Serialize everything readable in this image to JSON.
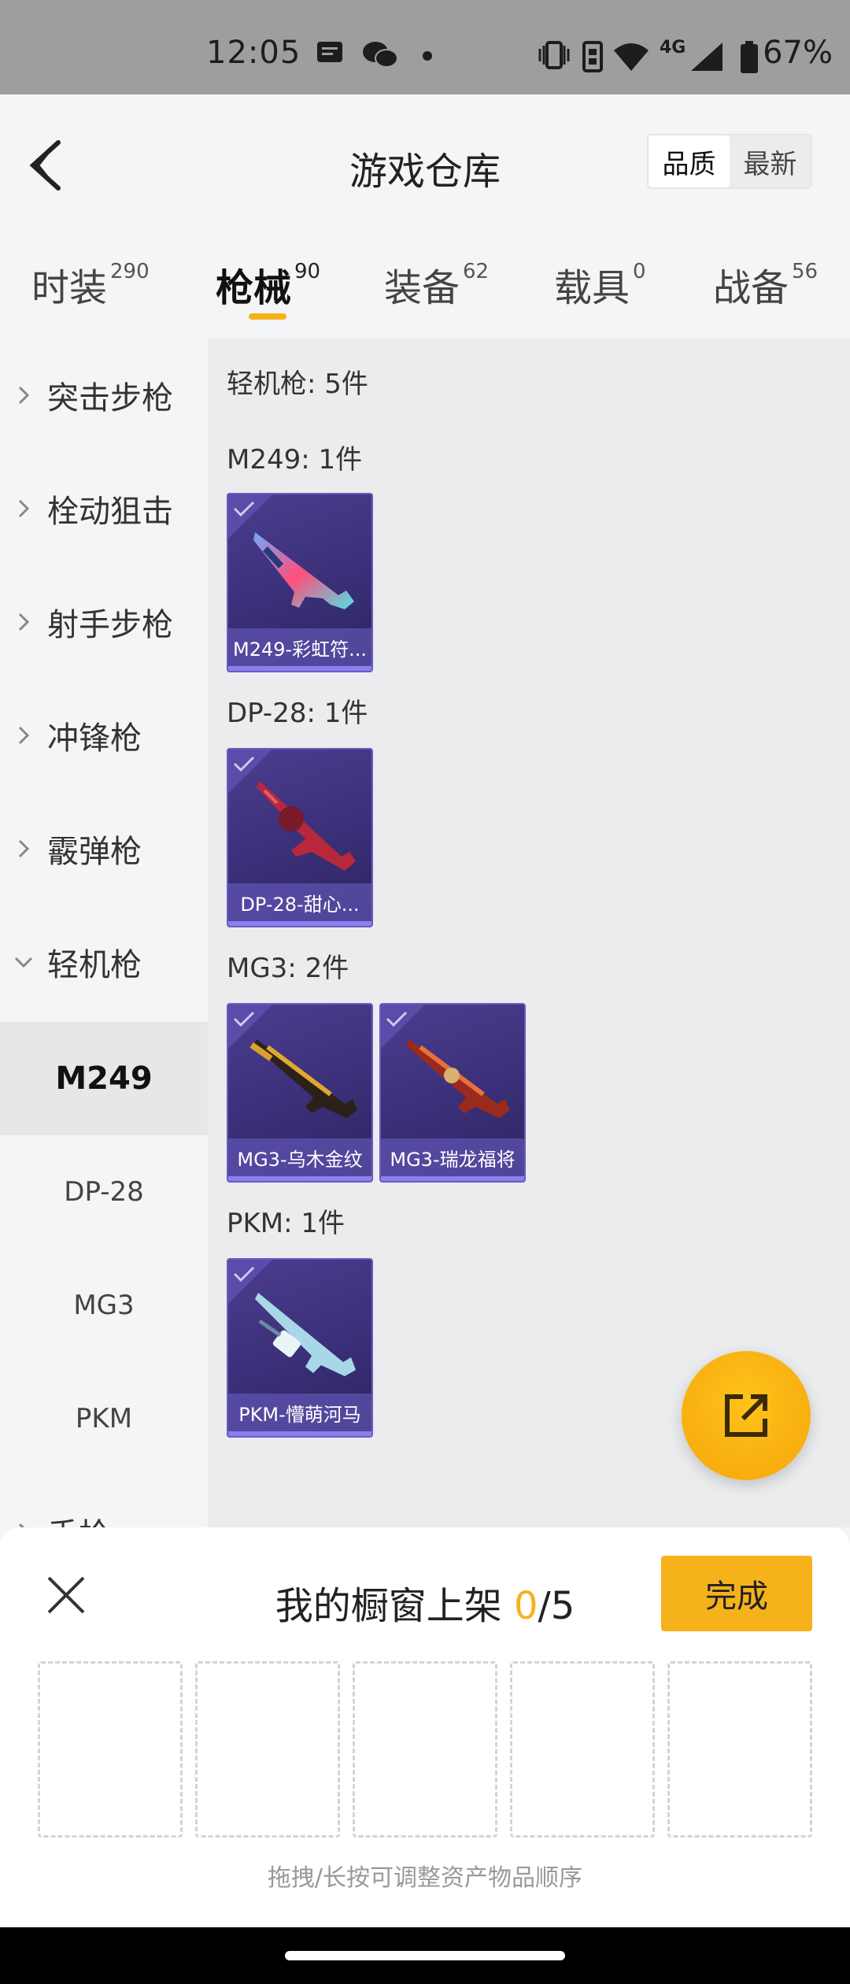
{
  "status_bar": {
    "time": "12:05",
    "battery": "67%",
    "network": "4G",
    "icons": [
      "message-icon",
      "wechat-icon",
      "dot-icon",
      "vibrate-icon",
      "data-saver-icon",
      "wifi-icon",
      "signal-icon",
      "battery-icon"
    ]
  },
  "header": {
    "title": "游戏仓库",
    "sort": {
      "options": [
        "品质",
        "最新"
      ],
      "selected": "品质"
    }
  },
  "tabs": [
    {
      "label": "时装",
      "count": "290"
    },
    {
      "label": "枪械",
      "count": "90",
      "active": true
    },
    {
      "label": "装备",
      "count": "62"
    },
    {
      "label": "载具",
      "count": "0"
    },
    {
      "label": "战备",
      "count": "56"
    }
  ],
  "sidebar": {
    "categories": [
      "突击步枪",
      "栓动狙击",
      "射手步枪",
      "冲锋枪",
      "霰弹枪",
      "轻机枪"
    ],
    "expanded": "轻机枪",
    "subitems": [
      "M249",
      "DP-28",
      "MG3",
      "PKM"
    ],
    "active_subitem": "M249",
    "next_category_partial": "手枪"
  },
  "content": {
    "summary": "轻机枪: 5件",
    "groups": [
      {
        "title": "M249: 1件",
        "items": [
          {
            "name": "M249-彩虹符..."
          }
        ]
      },
      {
        "title": "DP-28: 1件",
        "items": [
          {
            "name": "DP-28-甜心..."
          }
        ]
      },
      {
        "title": "MG3: 2件",
        "items": [
          {
            "name": "MG3-乌木金纹"
          },
          {
            "name": "MG3-瑞龙福将"
          }
        ]
      },
      {
        "title": "PKM: 1件",
        "items": [
          {
            "name": "PKM-懵萌河马"
          }
        ]
      }
    ]
  },
  "fab": {
    "icon": "share-external-icon"
  },
  "sheet": {
    "title": "我的橱窗上架",
    "current": "0",
    "total": "/5",
    "done_label": "完成",
    "hint": "拖拽/长按可调整资产物品顺序",
    "slots": 5
  },
  "colors": {
    "accent": "#f5b21b",
    "card": "#3a2f78"
  }
}
